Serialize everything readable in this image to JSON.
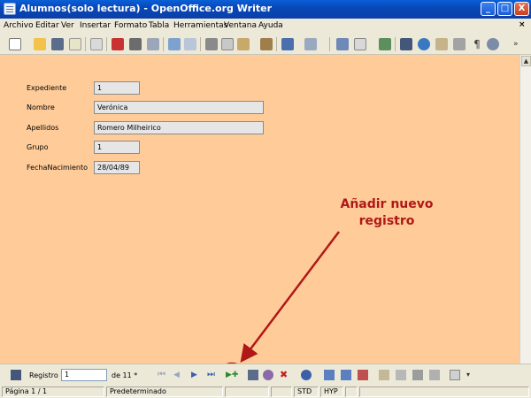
{
  "window": {
    "title": "Alumnos(solo lectura) - OpenOffice.org Writer",
    "minimize": "_",
    "maximize": "□",
    "close": "X"
  },
  "menu": [
    "Archivo",
    "Editar",
    "Ver",
    "Insertar",
    "Formato",
    "Tabla",
    "Herramientas",
    "Ventana",
    "Ayuda"
  ],
  "form": {
    "fields": [
      {
        "label": "Expediente",
        "value": "1"
      },
      {
        "label": "Nombre",
        "value": "Verónica"
      },
      {
        "label": "Apellidos",
        "value": "Romero Milheirico"
      },
      {
        "label": "Grupo",
        "value": "1"
      },
      {
        "label": "FechaNacimiento",
        "value": "28/04/89"
      }
    ],
    "background_color": "#ffcc99"
  },
  "annotation": {
    "line1": "Añadir nuevo",
    "line2": "registro",
    "color": "#b01818"
  },
  "navigation": {
    "record_label": "Registro",
    "record_value": "1",
    "total_label": "de 11 *",
    "icons": [
      "find-icon",
      "first-record-icon",
      "previous-record-icon",
      "next-record-icon",
      "last-record-icon",
      "new-record-icon",
      "save-record-icon",
      "undo-record-icon",
      "delete-record-icon",
      "refresh-icon",
      "sort-ascending-icon",
      "sort-descending-icon",
      "sort-icon",
      "autofilter-icon",
      "standard-filter-icon",
      "apply-filter-icon",
      "remove-filter-icon",
      "data-to-text-icon"
    ]
  },
  "status": {
    "page": "Página  1 / 1",
    "style": "Predeterminado",
    "mode": "STD",
    "hyp": "HYP"
  }
}
